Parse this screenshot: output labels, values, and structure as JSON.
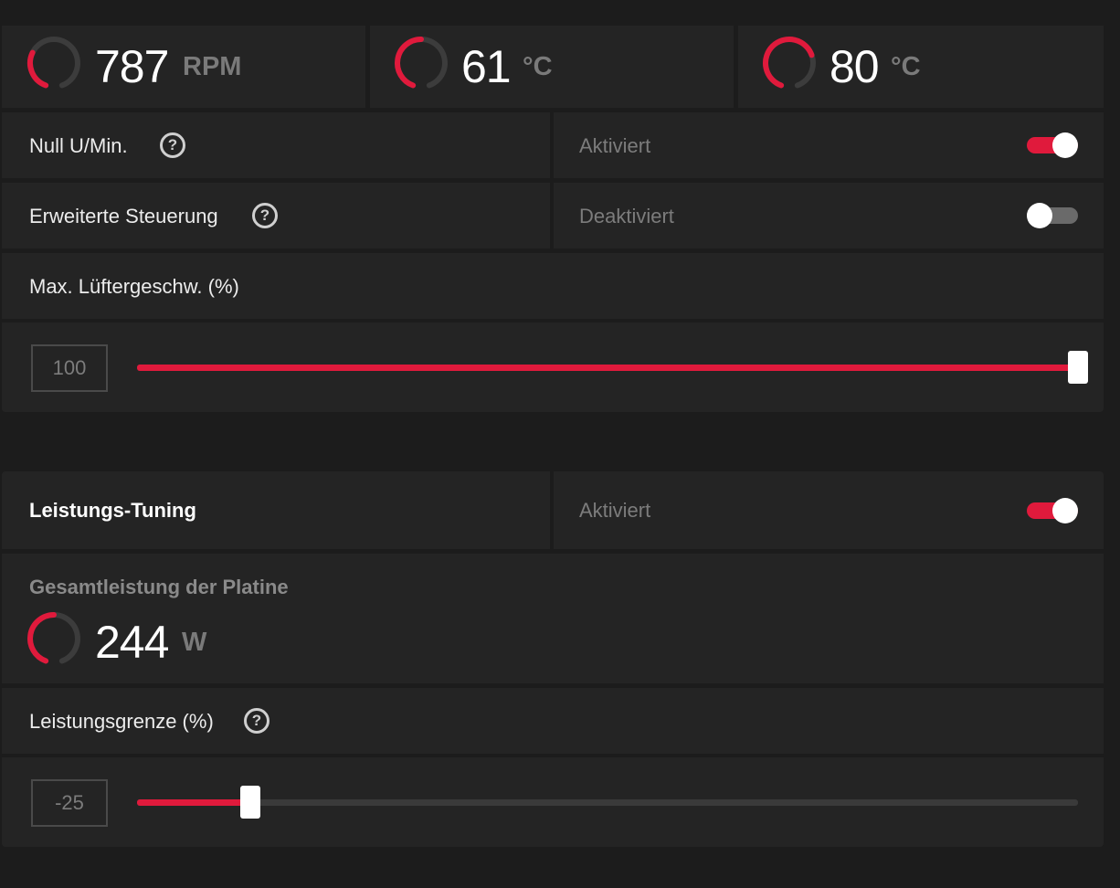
{
  "colors": {
    "accent": "#e01a3c",
    "panel": "#242424",
    "background": "#1c1c1c"
  },
  "metrics": {
    "fan_speed": {
      "value": "787",
      "unit": "RPM",
      "gauge": 0.3
    },
    "gpu_temp": {
      "value": "61",
      "unit": "°C",
      "gauge": 0.5
    },
    "junction_temp": {
      "value": "80",
      "unit": "°C",
      "gauge": 0.72
    }
  },
  "fan": {
    "zero_rpm": {
      "label": "Null U/Min.",
      "help_icon": "help-icon",
      "status": "Aktiviert",
      "enabled": true
    },
    "advanced_control": {
      "label": "Erweiterte Steuerung",
      "help_icon": "help-icon",
      "status": "Deaktiviert",
      "enabled": false
    },
    "max_speed": {
      "label": "Max. Lüftergeschw. (%)",
      "value": "100",
      "slider_fraction": 1.0
    }
  },
  "power": {
    "tuning": {
      "label": "Leistungs-Tuning",
      "status": "Aktiviert",
      "enabled": true
    },
    "board_power": {
      "label": "Gesamtleistung der Platine",
      "value": "244",
      "unit": "W",
      "gauge": 0.5
    },
    "limit": {
      "label": "Leistungsgrenze (%)",
      "help_icon": "help-icon",
      "value": "-25",
      "slider_fraction": 0.12
    }
  }
}
